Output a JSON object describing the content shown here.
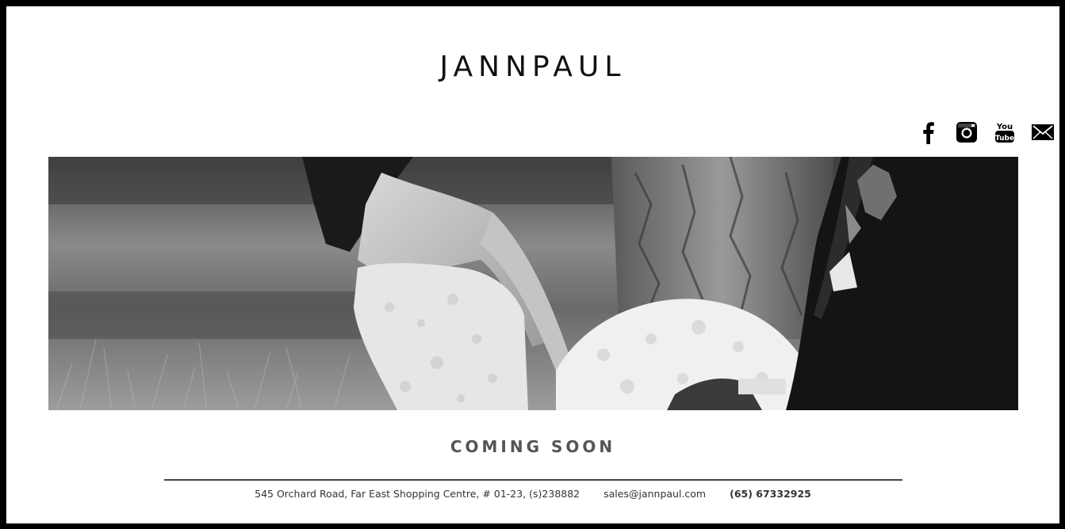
{
  "header": {
    "brand": "JANNPAUL"
  },
  "social": [
    {
      "name": "facebook-icon"
    },
    {
      "name": "instagram-icon"
    },
    {
      "name": "youtube-icon",
      "label_top": "You",
      "label_bottom": "Tube"
    },
    {
      "name": "mail-icon"
    }
  ],
  "hero": {
    "description_icon": "wedding-photo"
  },
  "main": {
    "heading": "COMING SOON"
  },
  "footer": {
    "address": "545 Orchard Road, Far East Shopping Centre, # 01-23, (s)238882",
    "email": "sales@jannpaul.com",
    "phone": "(65) 67332925"
  },
  "colors": {
    "frame": "#000000",
    "background": "#ffffff",
    "heading": "#555555",
    "text": "#333333"
  }
}
